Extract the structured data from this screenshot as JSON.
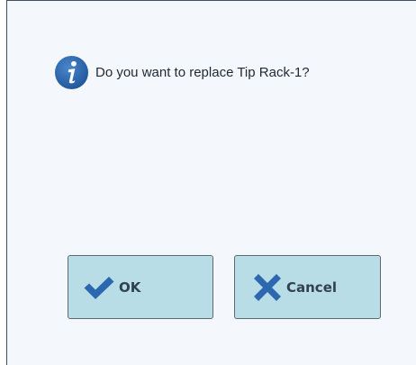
{
  "dialog": {
    "message": "Do you want to replace Tip Rack-1?",
    "icon": "info-icon",
    "ok_label": "OK",
    "ok_icon": "checkmark-icon",
    "cancel_label": "Cancel",
    "cancel_icon": "x-icon"
  },
  "colors": {
    "dialog_bg": "#f4f8fc",
    "button_bg": "#b9dde6",
    "icon_blue": "#2c68b0"
  }
}
